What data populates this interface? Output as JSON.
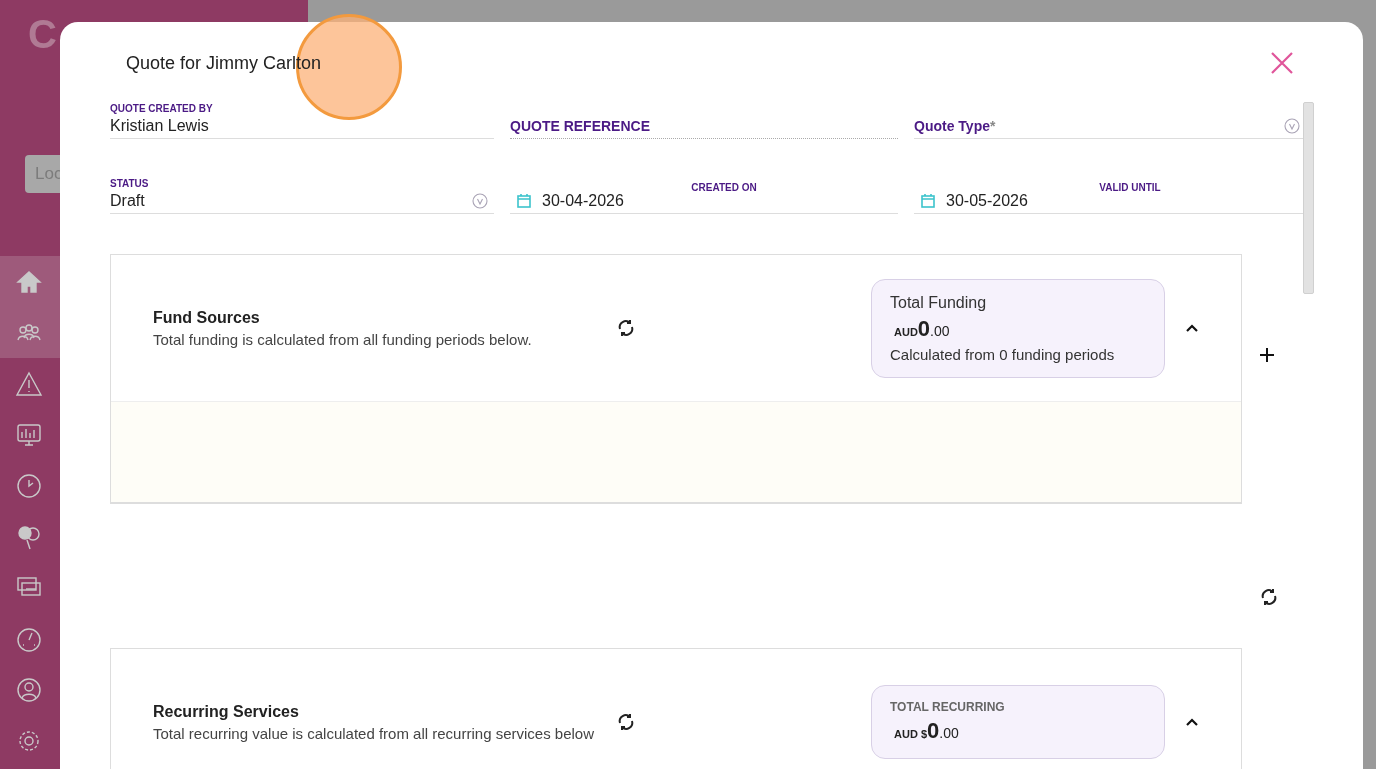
{
  "background": {
    "logo": "C",
    "login_field": {
      "placeholder": "Loc"
    },
    "nav_items": [
      {
        "kind": "home",
        "selected": true
      },
      {
        "kind": "people",
        "selected": true
      },
      {
        "kind": "alert",
        "selected": false
      },
      {
        "kind": "monitor",
        "selected": false
      },
      {
        "kind": "clock",
        "selected": false
      },
      {
        "kind": "balloons",
        "selected": false
      },
      {
        "kind": "chat",
        "selected": false
      },
      {
        "kind": "gauge",
        "selected": false
      },
      {
        "kind": "user",
        "selected": false
      },
      {
        "kind": "settings",
        "selected": false
      }
    ]
  },
  "modal": {
    "title": "Quote for Jimmy Carlton",
    "fields": [
      {
        "kind": "text",
        "label": "QUOTE CREATED BY",
        "value": "Kristian Lewis"
      },
      {
        "kind": "reference",
        "label": "QUOTE REFERENCE"
      },
      {
        "kind": "select",
        "label": "Quote Type",
        "required_mark": "*"
      },
      {
        "kind": "select",
        "label": "STATUS",
        "value": "Draft"
      },
      {
        "kind": "date",
        "label": "CREATED ON",
        "value": "30-04-2026"
      },
      {
        "kind": "date",
        "label": "VALID UNTIL",
        "value": "30-05-2026"
      }
    ],
    "sections": [
      {
        "kind": "funding",
        "title": "Fund Sources",
        "subtitle": "Total funding is calculated from all funding periods below.",
        "expanded": true,
        "summary": {
          "heading": "Total Funding",
          "currency": "AUD",
          "amount_whole": "0",
          "amount_cents": ".00",
          "note": "Calculated from 0 funding periods"
        }
      },
      {
        "kind": "recurring",
        "title": "Recurring Services",
        "subtitle": "Total recurring value is calculated from all recurring services below",
        "expanded": true,
        "summary": {
          "heading": "TOTAL RECURRING",
          "currency": "AUD $",
          "amount_whole": "0",
          "amount_cents": ".00"
        }
      }
    ]
  }
}
